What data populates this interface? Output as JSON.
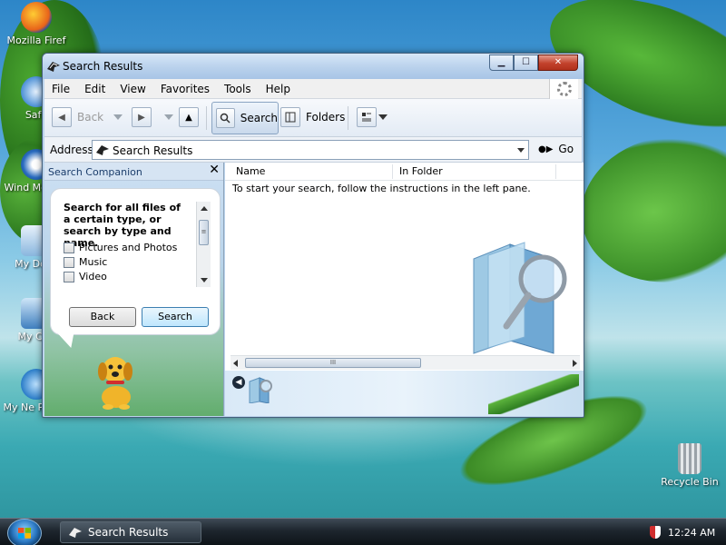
{
  "desktop": {
    "icons": [
      {
        "label": "Mozilla Firef",
        "icon": "firefox-icon"
      },
      {
        "label": "Safa",
        "icon": "safari-icon"
      },
      {
        "label": "Wind Media I",
        "icon": "media-player-icon"
      },
      {
        "label": "My Docu",
        "icon": "documents-icon"
      },
      {
        "label": "My Con",
        "icon": "computer-icon"
      },
      {
        "label": "My Ne Places",
        "icon": "network-icon"
      },
      {
        "label": "Recycle Bin",
        "icon": "recycle-bin-icon"
      }
    ]
  },
  "window": {
    "title": "Search Results",
    "controls": {
      "minimize": "▁",
      "maximize": "☐",
      "close": "✕"
    },
    "menu": [
      "File",
      "Edit",
      "View",
      "Favorites",
      "Tools",
      "Help"
    ],
    "toolbar": {
      "back": "Back",
      "search": "Search",
      "folders": "Folders"
    },
    "address": {
      "label": "Address",
      "value": "Search Results",
      "go": "Go"
    }
  },
  "search_companion": {
    "header": "Search Companion",
    "close": "✕",
    "prompt": "Search for all files of a certain type, or search by type and name.",
    "options": [
      "Pictures and Photos",
      "Music",
      "Video"
    ],
    "back_button": "Back",
    "search_button": "Search"
  },
  "results": {
    "columns": [
      "Name",
      "In Folder"
    ],
    "instructions": "To start your search, follow the instructions in the left pane.",
    "hscroll_thumb": "III",
    "vscroll_thumb": "≡"
  },
  "taskbar": {
    "task_label": "Search Results",
    "clock": "12:24 AM"
  },
  "colors": {
    "accent": "#2b78c2",
    "titlebar": "#b9d1ec",
    "close_button": "#c2412b"
  }
}
